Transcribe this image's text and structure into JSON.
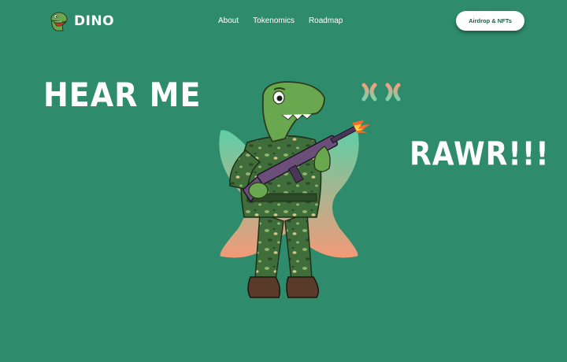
{
  "brand": {
    "name": "DINO",
    "logo_icon": "dino-head-icon"
  },
  "nav": {
    "links": [
      {
        "label": "About"
      },
      {
        "label": "Tokenomics"
      },
      {
        "label": "Roadmap"
      }
    ],
    "cta_label": "Airdrop & NFTs"
  },
  "hero": {
    "headline_left": "HEAR ME",
    "headline_right": "RAWR!!!",
    "art_icon": "soldier-dino-with-rifle-illustration",
    "decoration_icon": "double-x-icon"
  },
  "colors": {
    "background": "#2e8b6b",
    "cta_background": "#ffffff",
    "cta_text": "#1f5b47",
    "gradient_top": "#5fcfa6",
    "gradient_bottom": "#f29a78"
  }
}
